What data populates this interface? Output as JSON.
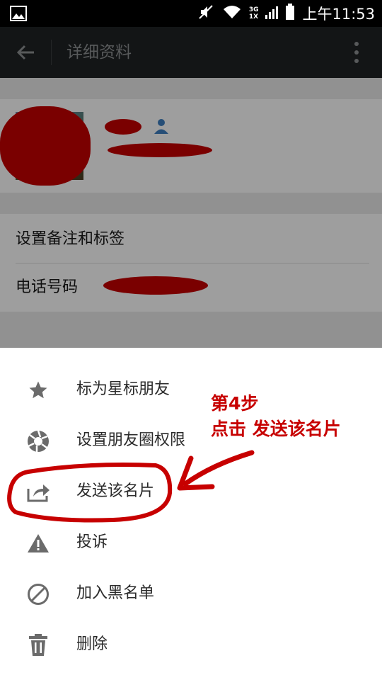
{
  "status_bar": {
    "network_top": "3G",
    "network_bottom": "1X",
    "time": "上午11:53"
  },
  "app_bar": {
    "title": "详细资料"
  },
  "profile": {
    "avatar_icon": "avatar-photo"
  },
  "settings": {
    "items": [
      {
        "label": "设置备注和标签"
      },
      {
        "label": "电话号码"
      }
    ]
  },
  "sheet_menu": {
    "items": [
      {
        "label": "标为星标朋友",
        "icon": "star-icon"
      },
      {
        "label": "设置朋友圈权限",
        "icon": "shutter-icon"
      },
      {
        "label": "发送该名片",
        "icon": "share-icon"
      },
      {
        "label": "投诉",
        "icon": "warning-icon"
      },
      {
        "label": "加入黑名单",
        "icon": "block-icon"
      },
      {
        "label": "删除",
        "icon": "trash-icon"
      }
    ]
  },
  "annotation": {
    "line1": "第4步",
    "line2": "点击 发送该名片",
    "color": "#c70000"
  },
  "colors": {
    "app_bar": "#1f2224",
    "accent_red": "#c70000",
    "icon_grey": "#6b6b6b"
  }
}
